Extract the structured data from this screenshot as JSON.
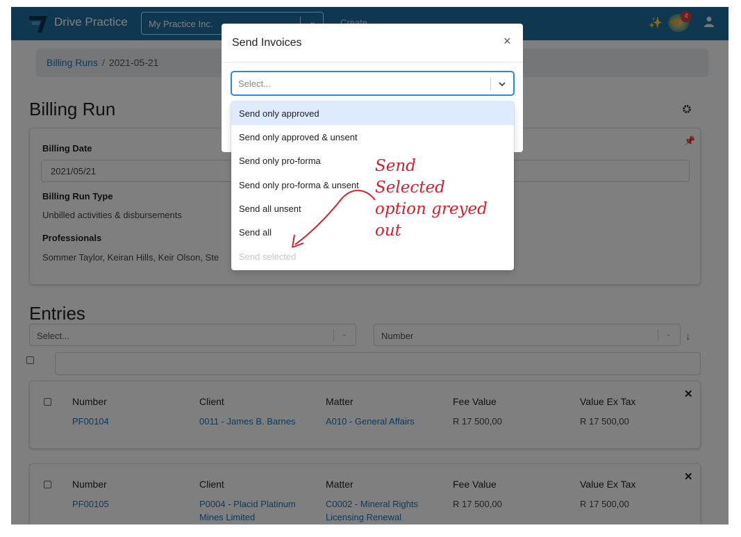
{
  "navbar": {
    "brand": "Drive Practice",
    "practice": "My Practice Inc.",
    "create": "Create",
    "notification_count": "4"
  },
  "breadcrumb": {
    "parent": "Billing Runs",
    "current": "2021-05-21"
  },
  "page": {
    "title": "Billing Run"
  },
  "billing": {
    "date_label": "Billing Date",
    "date_value": "2021/05/21",
    "type_label": "Billing Run Type",
    "type_value": "Unbilled activities & disbursements",
    "professionals_label": "Professionals",
    "professionals_value": "Sommer Taylor, Keiran Hills, Keir Olson, Ste"
  },
  "entries": {
    "title": "Entries",
    "filter_placeholder": "Select...",
    "sort_value": "Number",
    "columns": [
      "Number",
      "Client",
      "Matter",
      "Fee Value",
      "Value Ex Tax"
    ],
    "rows": [
      {
        "number": "PF00104",
        "client": "0011 - James B. Barnes",
        "matter": "A010 - General Affairs",
        "fee": "R 17 500,00",
        "ex_tax": "R 17 500,00"
      },
      {
        "number": "PF00105",
        "client": "P0004 - Placid Platinum Mines Limited",
        "matter": "C0002 - Mineral Rights Licensing Renewal",
        "fee": "R 17 500,00",
        "ex_tax": "R 17 500,00"
      }
    ]
  },
  "modal": {
    "title": "Send Invoices",
    "placeholder": "Select...",
    "options": [
      {
        "label": "Send only approved",
        "highlighted": true,
        "disabled": false
      },
      {
        "label": "Send only approved & unsent",
        "highlighted": false,
        "disabled": false
      },
      {
        "label": "Send only pro-forma",
        "highlighted": false,
        "disabled": false
      },
      {
        "label": "Send only pro-forma & unsent",
        "highlighted": false,
        "disabled": false
      },
      {
        "label": "Send all unsent",
        "highlighted": false,
        "disabled": false
      },
      {
        "label": "Send all",
        "highlighted": false,
        "disabled": false
      },
      {
        "label": "Send selected",
        "highlighted": false,
        "disabled": true
      }
    ]
  },
  "annotation": {
    "text": "Send\nSelected\noption greyed\nout",
    "color": "#d61f2a"
  },
  "colors": {
    "navbar": "#1f6f9e",
    "link": "#1f73b7",
    "focus": "#2684ff"
  }
}
